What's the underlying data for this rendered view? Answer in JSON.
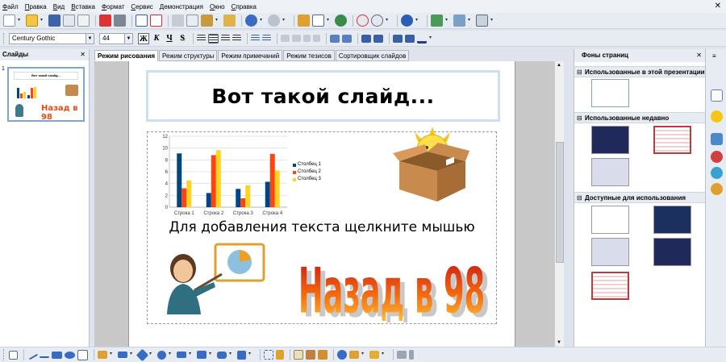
{
  "menu": {
    "items": [
      {
        "label": "Файл",
        "u": "Ф",
        "rest": "айл"
      },
      {
        "label": "Правка",
        "u": "П",
        "rest": "равка"
      },
      {
        "label": "Вид",
        "u": "В",
        "rest": "ид"
      },
      {
        "label": "Вставка",
        "u": "В",
        "rest": "ставка"
      },
      {
        "label": "Формат",
        "u": "Ф",
        "rest": "ормат"
      },
      {
        "label": "Сервис",
        "u": "С",
        "rest": "ервис"
      },
      {
        "label": "Демонстрация",
        "u": "Д",
        "rest": "емонстрация"
      },
      {
        "label": "Окно",
        "u": "О",
        "rest": "кно"
      },
      {
        "label": "Справка",
        "u": "С",
        "rest": "правка"
      }
    ],
    "close_glyph": "✕"
  },
  "format_toolbar": {
    "font_name": "Century Gothic",
    "font_size": "44",
    "bold": "Ж",
    "italic": "К",
    "underline": "Ч",
    "shadow": "S"
  },
  "slides_pane": {
    "title": "Слайды",
    "close": "✕",
    "slide_number": "1",
    "thumb_title": "Вот такой слайд..."
  },
  "view_tabs": [
    "Режим рисования",
    "Режим структуры",
    "Режим примечаний",
    "Режим тезисов",
    "Сортировщик слайдов"
  ],
  "slide": {
    "title": "Вот такой слайд...",
    "body_placeholder": "Для добавления текста щелкните мышью",
    "wordart": "Назад в 98"
  },
  "chart_data": {
    "type": "bar",
    "categories": [
      "Строка 1",
      "Строка 2",
      "Строка 3",
      "Строка 4"
    ],
    "series": [
      {
        "name": "Столбец 1",
        "values": [
          9.1,
          2.4,
          3.1,
          4.3
        ],
        "color": "#004586"
      },
      {
        "name": "Столбец 2",
        "values": [
          3.2,
          8.8,
          1.5,
          9.02
        ],
        "color": "#ff420e"
      },
      {
        "name": "Столбец 3",
        "values": [
          4.54,
          9.65,
          3.7,
          6.2
        ],
        "color": "#ffd320"
      }
    ],
    "ylim": [
      0,
      12
    ],
    "yticks": [
      "0",
      "2",
      "4",
      "6",
      "8",
      "10",
      "12"
    ],
    "legend": "right",
    "grid": true
  },
  "right_pane": {
    "title": "Фоны страниц",
    "close": "✕",
    "sections": [
      "Использованные в этой презентации",
      "Использованные недавно",
      "Доступные для использования"
    ]
  },
  "colors": {
    "accent": "#7ea3d6",
    "title_border": "#cde0f3",
    "dark_blue_master": "#202a5a",
    "red_stripe_master": "#b24040"
  }
}
